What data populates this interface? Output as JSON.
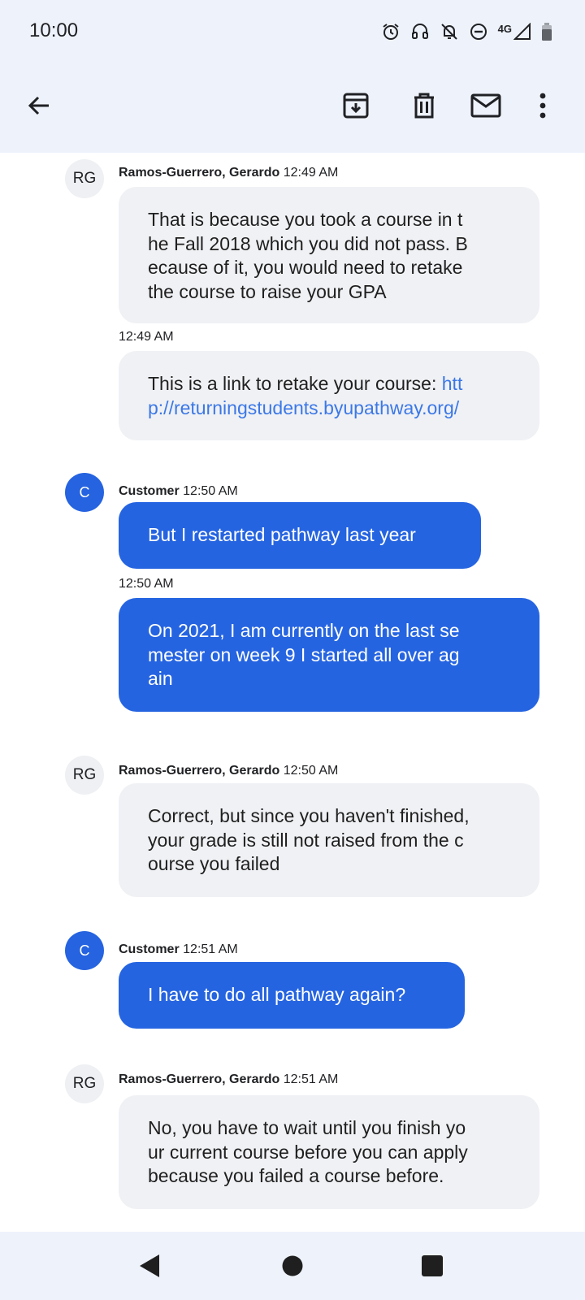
{
  "status_bar": {
    "time": "10:00",
    "network": "4G",
    "icons": [
      "alarm-icon",
      "headset-icon",
      "notifications-off-icon",
      "do-not-disturb-icon",
      "signal-icon",
      "battery-icon"
    ]
  },
  "app_bar": {
    "icons": [
      "back-arrow-icon",
      "archive-icon",
      "delete-icon",
      "mark-unread-icon",
      "more-vert-icon"
    ]
  },
  "messages": [
    {
      "avatar": "RG",
      "sender": "Ramos-Guerrero, Gerardo",
      "time": "12:49 AM",
      "bubble1_lines": [
        "That is because you took a course in t",
        "he Fall 2018 which you did not pass. B",
        "ecause of it, you would need to retake",
        "the course to raise your GPA"
      ],
      "second_time": "12:49 AM",
      "bubble2_prefix": "This is a link to retake your course: ",
      "bubble2_link_lines": [
        "htt",
        "p://returningstudents.byupathway.org/"
      ]
    },
    {
      "avatar": "C",
      "sender": "Customer",
      "time": "12:50 AM",
      "bubble1": "But I restarted pathway last year",
      "second_time": "12:50 AM",
      "bubble2_lines": [
        "On 2021, I am currently on the last se",
        "mester on week 9 I started all over ag",
        "ain"
      ]
    },
    {
      "avatar": "RG",
      "sender": "Ramos-Guerrero, Gerardo",
      "time": "12:50 AM",
      "bubble1_lines": [
        "Correct, but since you haven't finished,",
        "your grade is still not raised from the c",
        "ourse you failed"
      ]
    },
    {
      "avatar": "C",
      "sender": "Customer",
      "time": "12:51 AM",
      "bubble1": "I have to do all pathway again?"
    },
    {
      "avatar": "RG",
      "sender": "Ramos-Guerrero, Gerardo",
      "time": "12:51 AM",
      "bubble1_lines": [
        "No, you have to wait until you finish yo",
        "ur current course before you can apply",
        "because you failed a course before."
      ]
    }
  ],
  "nav_bar": {
    "icons": [
      "nav-back-icon",
      "nav-home-icon",
      "nav-recents-icon"
    ]
  },
  "colors": {
    "customer_bubble": "#2564e1",
    "agent_bubble": "#f0f1f4",
    "bar_background": "#eef2fb",
    "link": "#3b78e7"
  }
}
